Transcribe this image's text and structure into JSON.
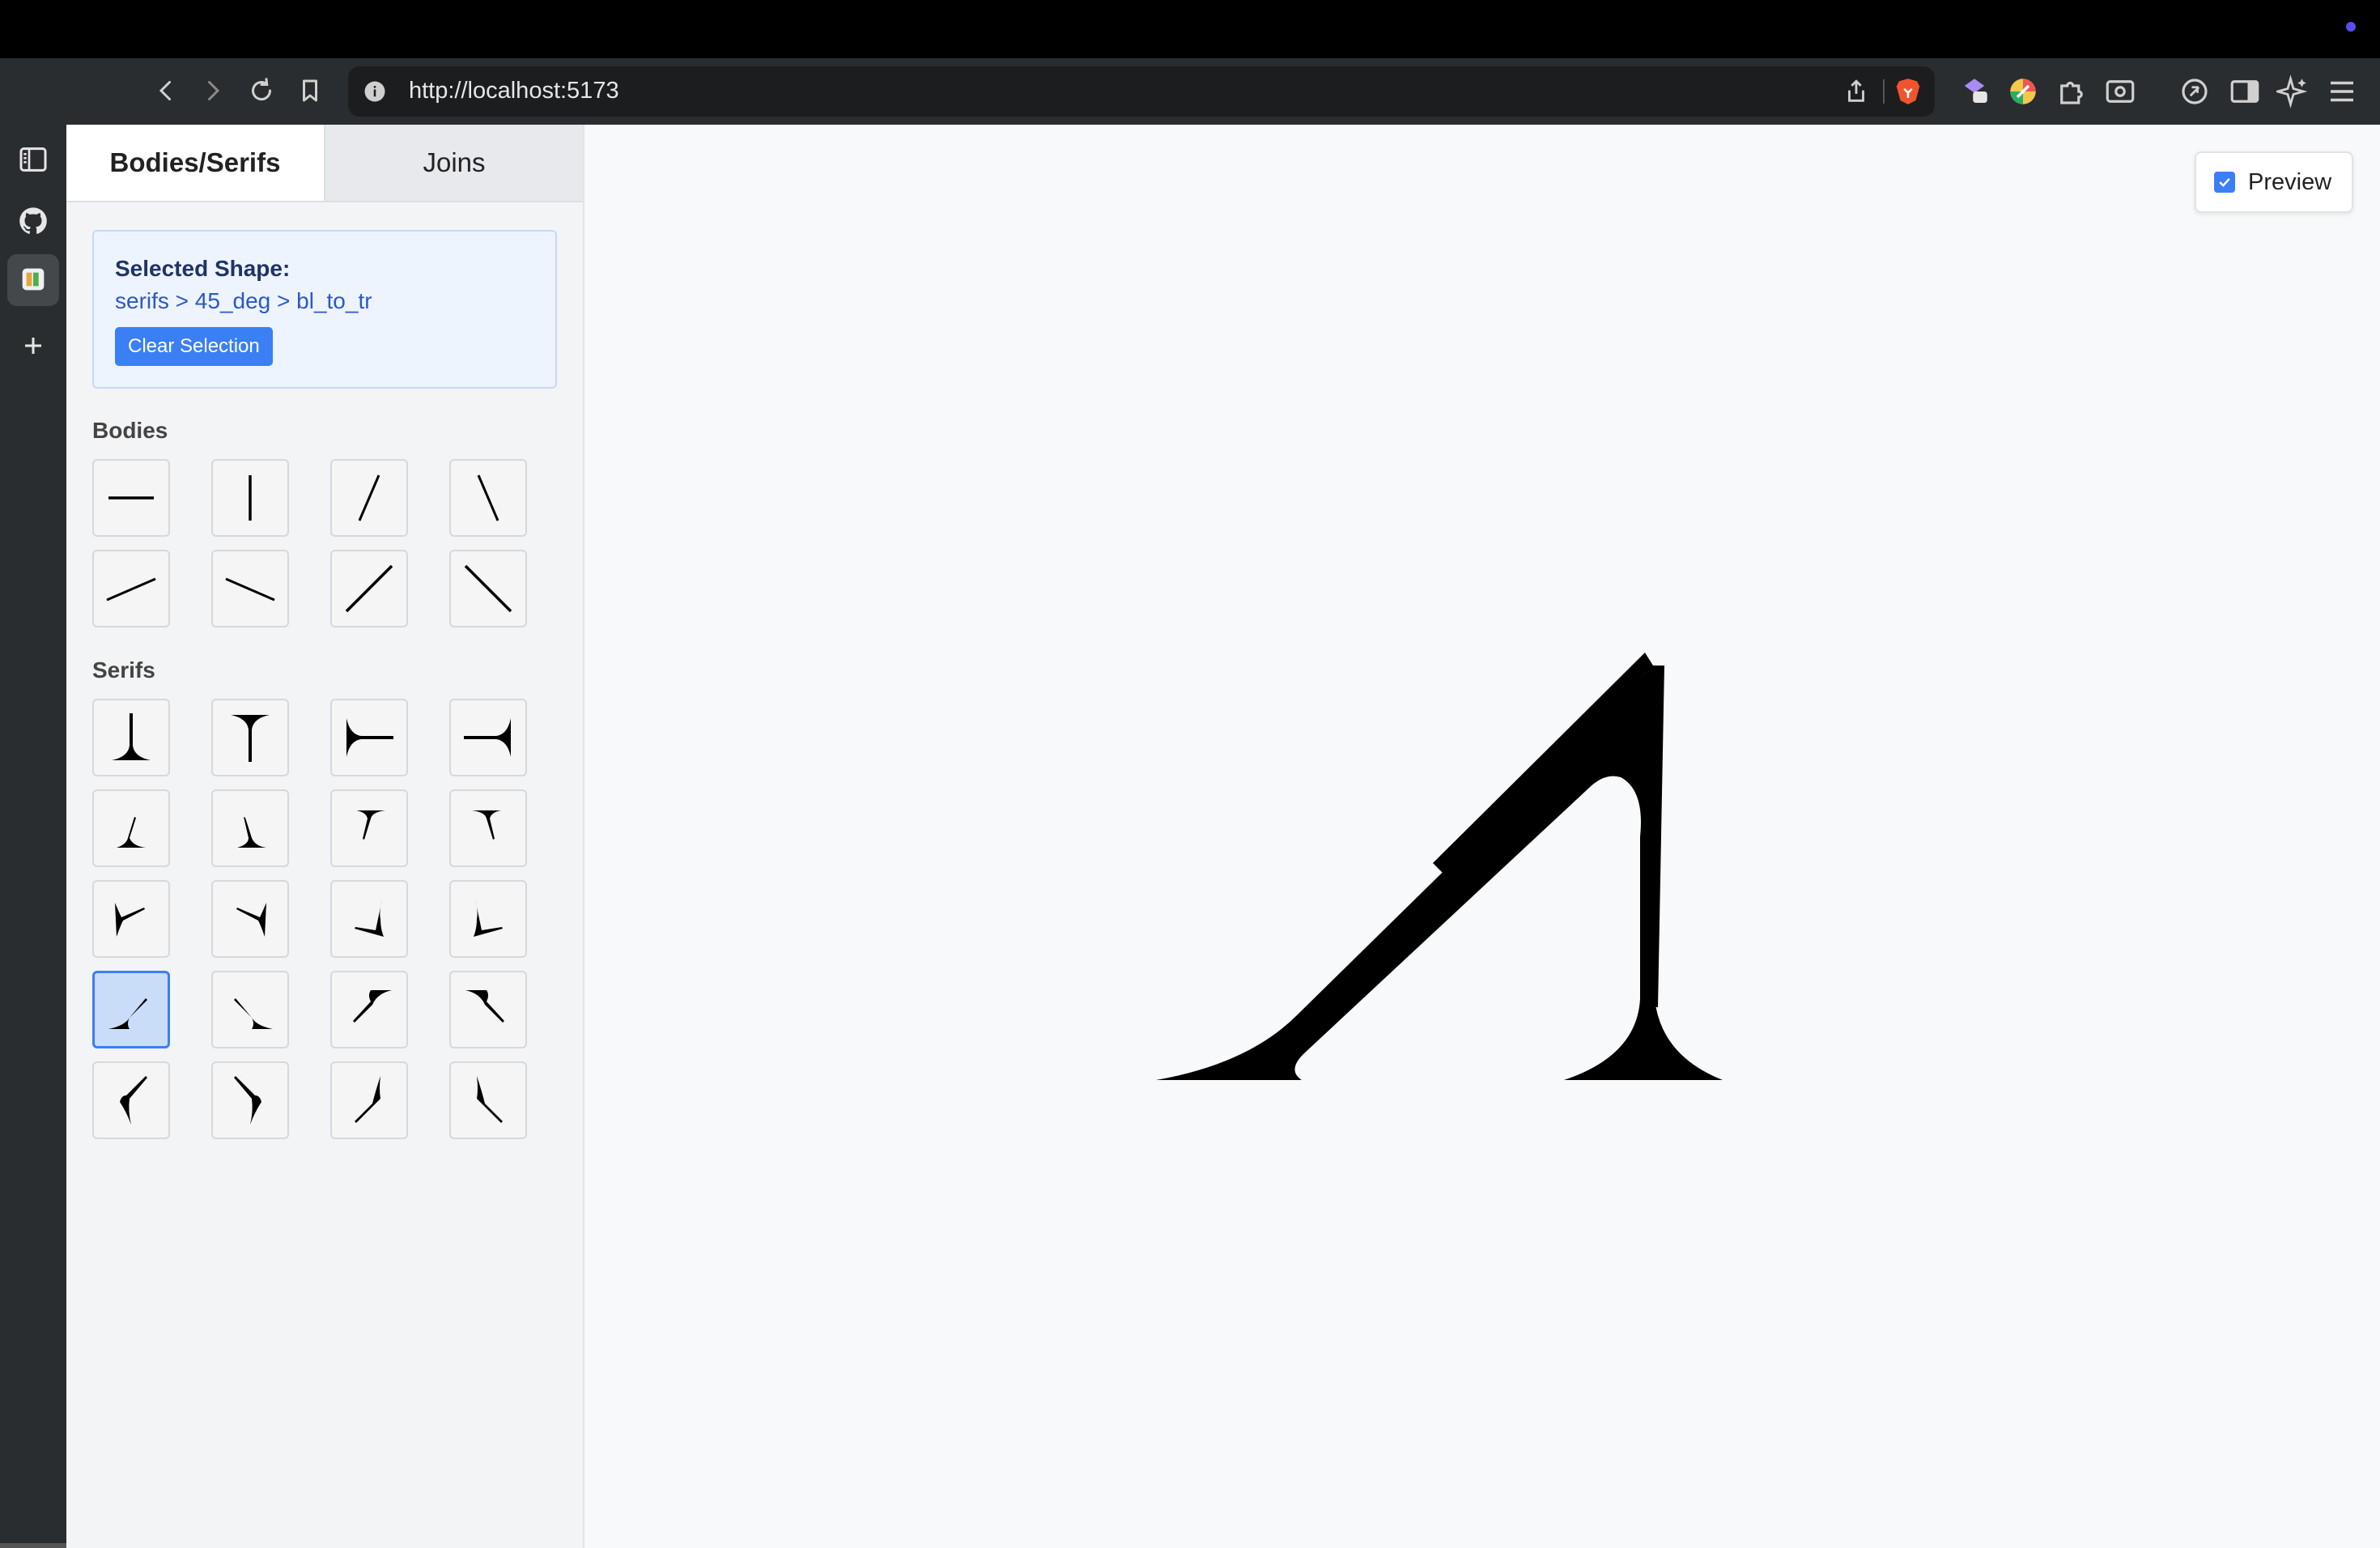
{
  "browser": {
    "url": "http://localhost:5173",
    "extensions": [
      "proton-pass-icon",
      "color-extension-icon",
      "puzzle-icon",
      "screenshot-icon",
      "leo-icon",
      "sidebar-icon",
      "ai-sparkle-icon",
      "menu-icon"
    ]
  },
  "sidebar_strip": {
    "icons": [
      "sidebar-toggle-icon",
      "github-icon",
      "app-icon",
      "plus-icon"
    ]
  },
  "panel": {
    "tabs": [
      {
        "label": "Bodies/Serifs",
        "active": true
      },
      {
        "label": "Joins",
        "active": false
      }
    ],
    "selection": {
      "heading": "Selected Shape:",
      "path": "serifs > 45_deg > bl_to_tr",
      "clear_label": "Clear Selection"
    },
    "bodies_title": "Bodies",
    "serifs_title": "Serifs"
  },
  "canvas": {
    "preview_label": "Preview",
    "preview_checked": true
  },
  "colors": {
    "accent": "#3b7ff5",
    "selected_bg": "#c9dcf8"
  }
}
